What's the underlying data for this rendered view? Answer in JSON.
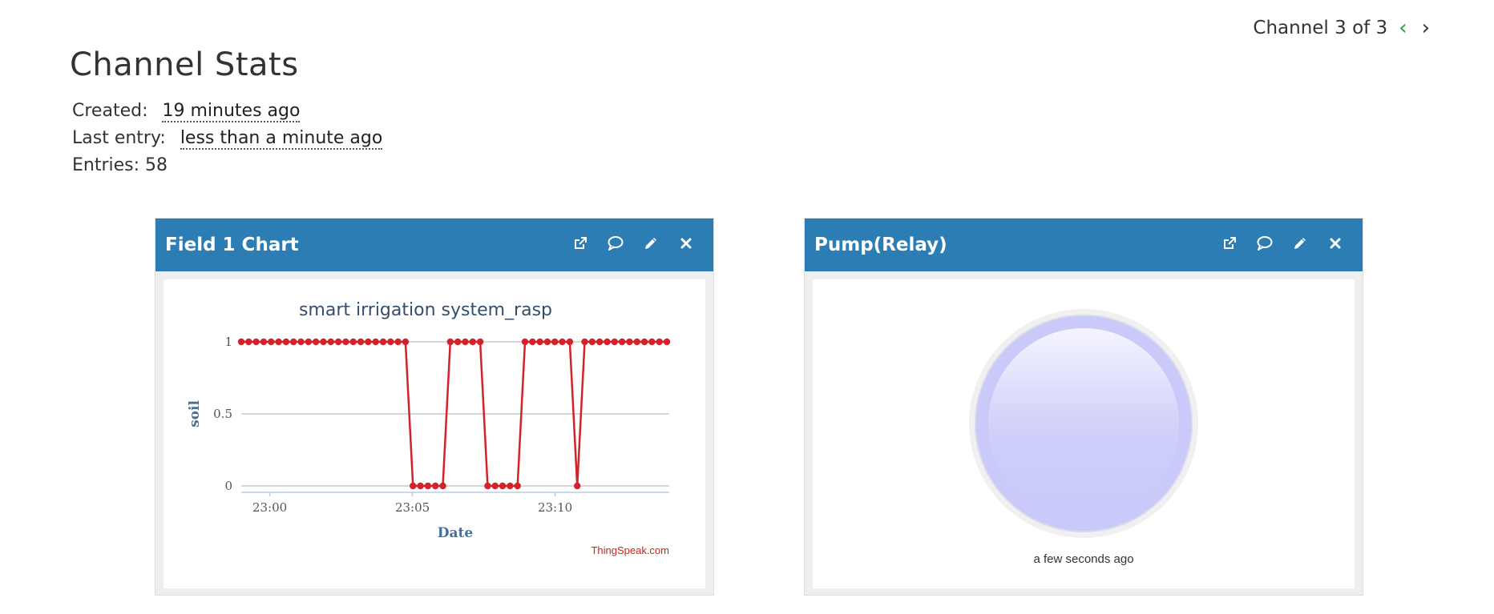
{
  "nav": {
    "channel_label": "Channel 3 of 3"
  },
  "page": {
    "title": "Channel Stats"
  },
  "stats": {
    "created_label": "Created:",
    "created_value": "19 minutes ago",
    "last_entry_label": "Last entry:",
    "last_entry_value": "less than a minute ago",
    "entries_text": "Entries: 58"
  },
  "widgets": {
    "field1": {
      "title": "Field 1 Chart"
    },
    "pump": {
      "title": "Pump(Relay)",
      "status": "a few seconds ago",
      "lamp_color": "#c9c9fa"
    }
  },
  "chart_data": {
    "type": "line",
    "title": "smart irrigation system_rasp",
    "xlabel": "Date",
    "ylabel": "soil",
    "credit": "ThingSpeak.com",
    "ylim": [
      0,
      1
    ],
    "yticks": [
      0,
      0.5,
      1
    ],
    "xticks": [
      "23:00",
      "23:05",
      "23:10"
    ],
    "x_range": [
      "22:59",
      "23:14"
    ],
    "grid": true,
    "line_color": "#d3222a",
    "series": [
      {
        "values": [
          1,
          1,
          1,
          1,
          1,
          1,
          1,
          1,
          1,
          1,
          1,
          1,
          1,
          1,
          1,
          1,
          1,
          1,
          1,
          1,
          1,
          1,
          1,
          0,
          0,
          0,
          0,
          0,
          1,
          1,
          1,
          1,
          1,
          0,
          0,
          0,
          0,
          0,
          1,
          1,
          1,
          1,
          1,
          1,
          1,
          0,
          1,
          1,
          1,
          1,
          1,
          1,
          1,
          1,
          1,
          1,
          1,
          1
        ]
      }
    ]
  }
}
